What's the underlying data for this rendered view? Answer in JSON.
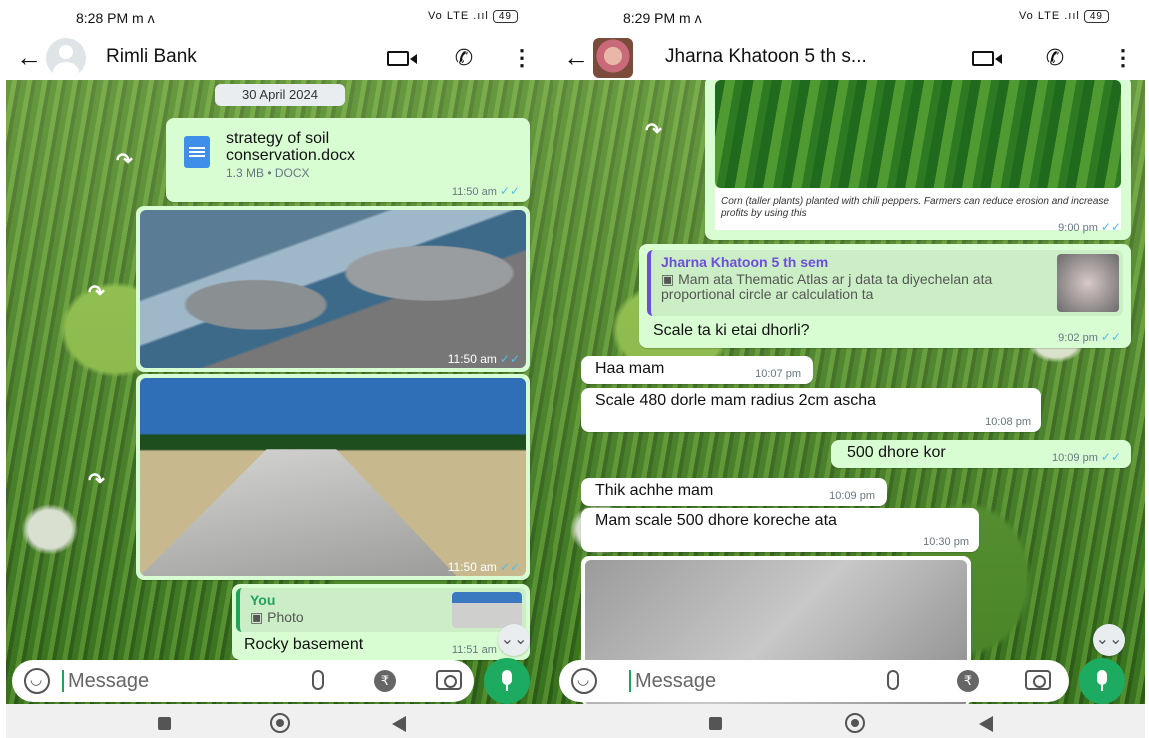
{
  "left": {
    "status": {
      "time": "8:28 PM",
      "carrier_glyph": "m ʌ",
      "signal": "Vo LTE .ııl",
      "battery": "49"
    },
    "header": {
      "title": "Rimli Bank"
    },
    "date_pill": "30 April 2024",
    "document": {
      "name_line1": "strategy of soil",
      "name_line2": "conservation.docx",
      "meta": "1.3 MB • DOCX",
      "time": "11:50 am"
    },
    "photo1": {
      "time": "11:50 am"
    },
    "photo2": {
      "time": "11:50 am"
    },
    "reply": {
      "quote_name": "You",
      "quote_text": "Photo",
      "text": "Rocky basement",
      "time": "11:51 am"
    },
    "composer": {
      "placeholder": "Message"
    }
  },
  "right": {
    "status": {
      "time": "8:29 PM",
      "carrier_glyph": "m ʌ",
      "signal": "Vo LTE .ııl",
      "battery": "49"
    },
    "header": {
      "title": "Jharna Khatoon 5 th s..."
    },
    "crop_caption": "Corn (taller plants) planted with chili peppers. Farmers can reduce erosion and increase profits by using this",
    "crop_time": "9:00 pm",
    "reply": {
      "quote_name": "Jharna Khatoon 5 th sem",
      "quote_text": "Mam ata Thematic Atlas ar j data ta diyechelan ata proportional circle ar calculation ta",
      "text": "Scale ta ki etai dhorli?",
      "time": "9:02 pm"
    },
    "messages": [
      {
        "text": "Haa mam",
        "time": "10:07 pm"
      },
      {
        "text": "Scale 480 dorle mam radius 2cm ascha",
        "time": "10:08 pm"
      },
      {
        "text": "500 dhore kor",
        "time": "10:09 pm"
      },
      {
        "text": "Thik achhe mam",
        "time": "10:09 pm"
      },
      {
        "text": "Mam scale 500 dhore koreche ata",
        "time": "10:30 pm"
      }
    ],
    "composer": {
      "placeholder": "Message"
    }
  },
  "icons": {
    "tick": "✓✓",
    "fwd": "↷",
    "scroll_down": "⌄⌄",
    "rupee": "₹"
  },
  "colors": {
    "outgoing": "#d9fdd3",
    "incoming": "#ffffff",
    "accent": "#1daa61",
    "tick_read": "#53bdeb"
  }
}
